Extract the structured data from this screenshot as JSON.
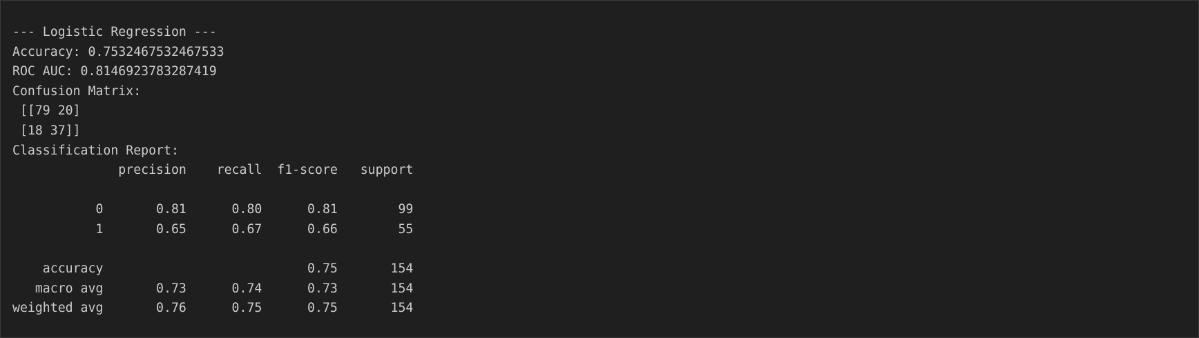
{
  "output": {
    "lines": [
      "--- Logistic Regression ---",
      "Accuracy: 0.7532467532467533",
      "ROC AUC: 0.8146923783287419",
      "Confusion Matrix:",
      " [[79 20]",
      " [18 37]]",
      "Classification Report:",
      "              precision    recall  f1-score   support",
      "",
      "           0       0.81      0.80      0.81        99",
      "           1       0.65      0.67      0.66        55",
      "",
      "    accuracy                           0.75       154",
      "   macro avg       0.73      0.74      0.73       154",
      "weighted avg       0.76      0.75      0.75       154"
    ]
  },
  "colors": {
    "background": "#1f1f1f",
    "text": "#cccccc",
    "border": "#3a3a3a"
  }
}
